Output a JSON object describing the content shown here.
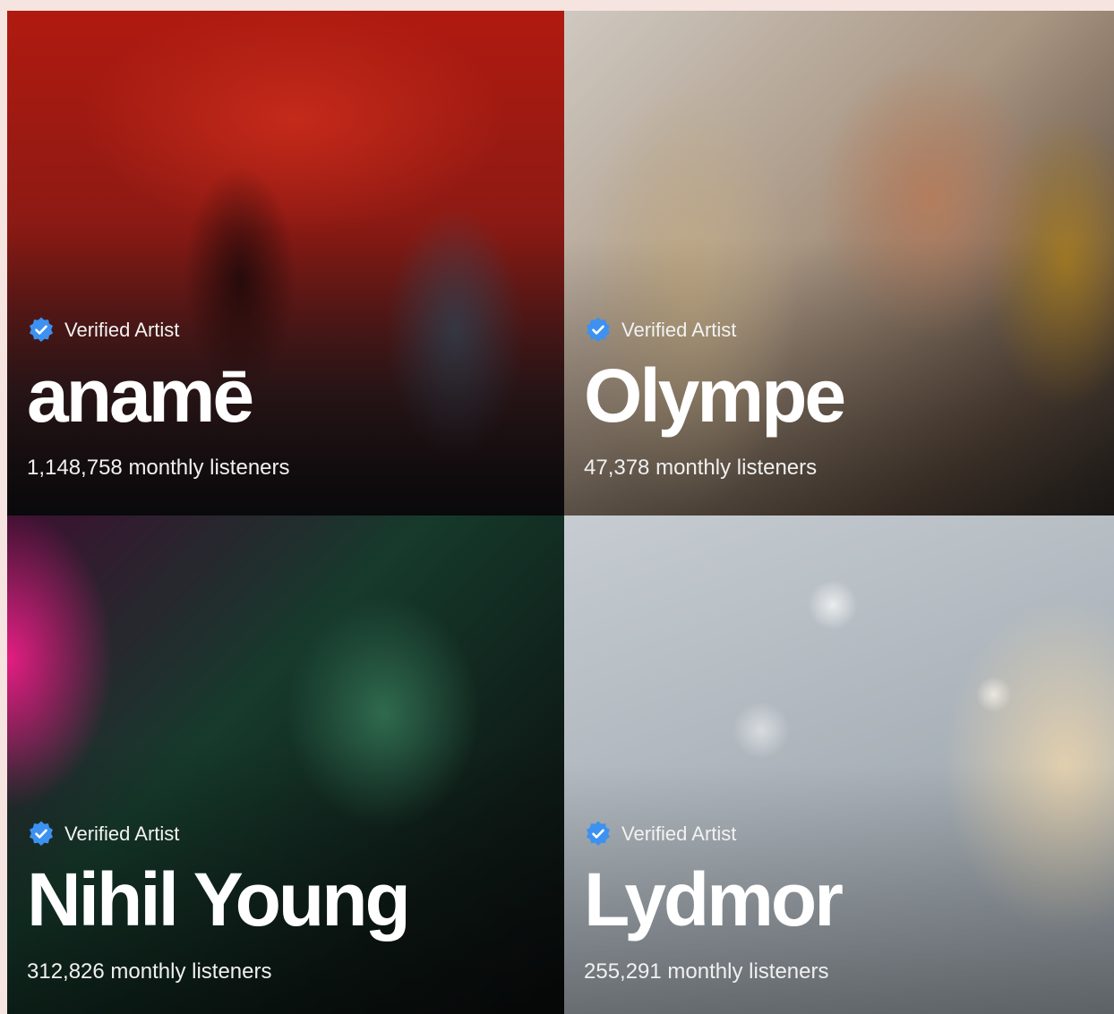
{
  "artists": [
    {
      "verified_label": "Verified Artist",
      "name": "anamē",
      "listeners": "1,148,758 monthly listeners"
    },
    {
      "verified_label": "Verified Artist",
      "name": "Olympe",
      "listeners": "47,378 monthly listeners"
    },
    {
      "verified_label": "Verified Artist",
      "name": "Nihil Young",
      "listeners": "312,826 monthly listeners"
    },
    {
      "verified_label": "Verified Artist",
      "name": "Lydmor",
      "listeners": "255,291 monthly listeners"
    }
  ],
  "icons": {
    "verified": "verified-badge-icon"
  },
  "colors": {
    "badge": "#3d91f0",
    "page_background": "#f6e4e1"
  }
}
